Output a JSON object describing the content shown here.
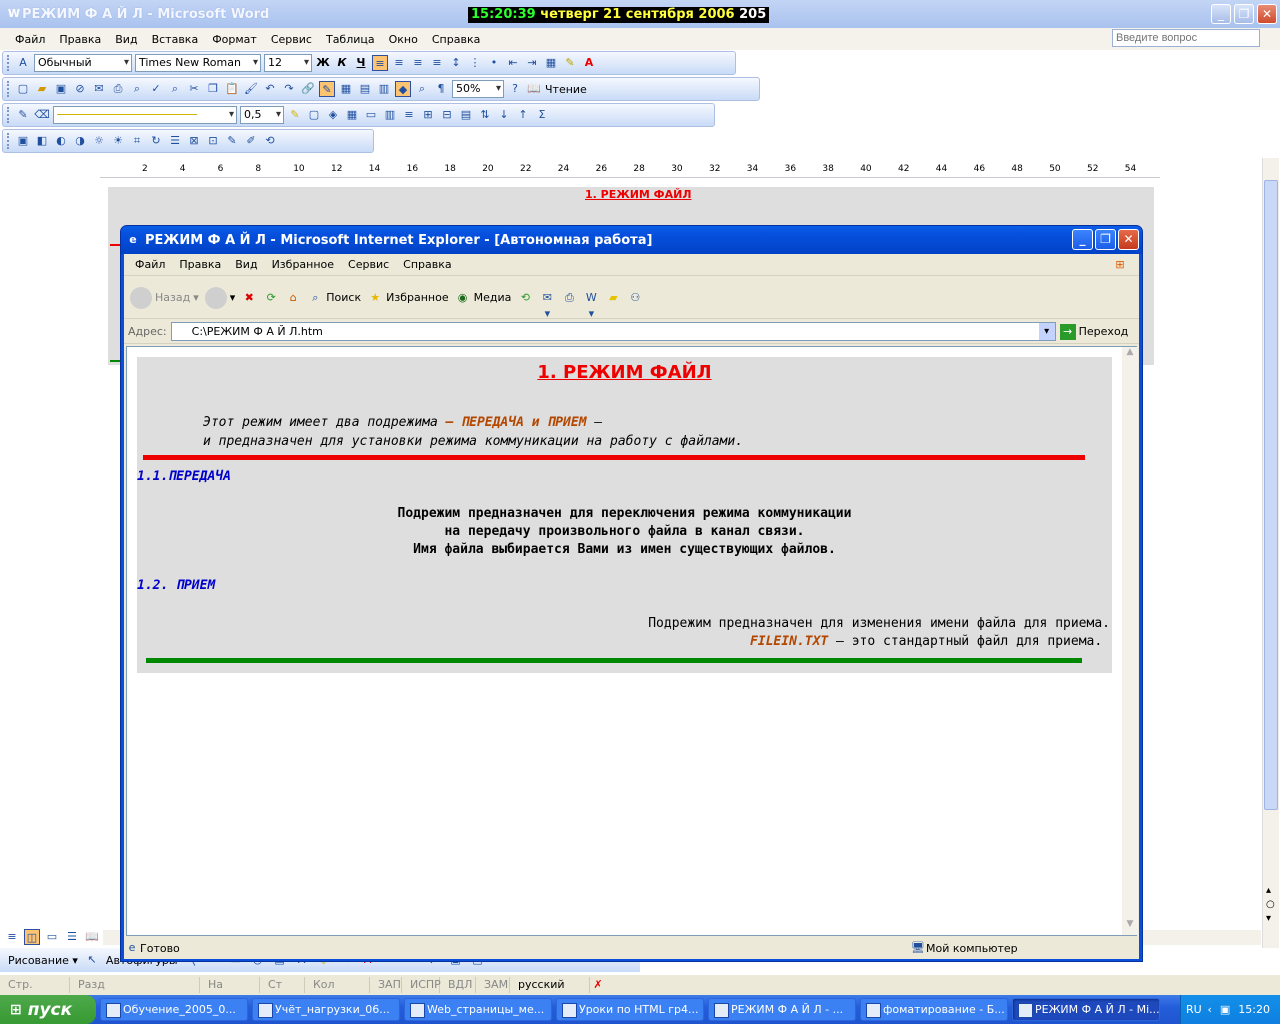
{
  "word": {
    "title": "РЕЖИМ  Ф А Й Л - Microsoft Word",
    "clock_time": "15:20:39",
    "clock_date": "четверг 21 сентября 2006",
    "clock_extra": "205",
    "menu": [
      "Файл",
      "Правка",
      "Вид",
      "Вставка",
      "Формат",
      "Сервис",
      "Таблица",
      "Окно",
      "Справка"
    ],
    "ask_placeholder": "Введите вопрос",
    "style": "Обычный",
    "font": "Times New Roman",
    "size": "12",
    "bold": "Ж",
    "italic": "К",
    "underline": "Ч",
    "zoom": "50%",
    "reading": "Чтение",
    "line_width": "0,5",
    "ruler": [
      "2",
      "4",
      "6",
      "8",
      "10",
      "12",
      "14",
      "16",
      "18",
      "20",
      "22",
      "24",
      "26",
      "28",
      "30",
      "32",
      "34",
      "36",
      "38",
      "40",
      "42",
      "44",
      "46",
      "48",
      "50",
      "52",
      "54"
    ],
    "doc_title": "1. РЕЖИМ  ФАЙЛ",
    "draw_label": "Рисование ▾",
    "autoshapes": "Автофигуры",
    "status": [
      "Стр.",
      "Разд",
      "На",
      "Ст",
      "Кол",
      "ЗАП",
      "ИСПР",
      "ВДЛ",
      "ЗАМ",
      "русский (Ро"
    ]
  },
  "ie": {
    "title": "РЕЖИМ Ф А Й Л - Microsoft Internet Explorer - [Автономная работа]",
    "menu": [
      "Файл",
      "Правка",
      "Вид",
      "Избранное",
      "Сервис",
      "Справка"
    ],
    "back": "Назад",
    "search": "Поиск",
    "favorites": "Избранное",
    "media": "Медиа",
    "address_label": "Адрес:",
    "address": "C:\\РЕЖИМ  Ф А Й Л.htm",
    "go": "Переход",
    "status_ready": "Готово",
    "status_zone": "Мой компьютер"
  },
  "page": {
    "title": "1. РЕЖИМ  ФАЙЛ",
    "intro1_a": "Этот режим имеет два подрежима ",
    "intro1_b": "– ПЕРЕДАЧА и ПРИЕМ",
    "intro1_c": " –",
    "intro2": "и предназначен для установки режима коммуникации на  работу с файлами.",
    "h_transfer": "1.1.ПЕРЕДАЧА",
    "t1": "Подрежим предназначен для переключения режима коммуникации",
    "t2": "на передачу произвольного файла в канал связи.",
    "t3": "Имя файла выбирается Вами из имен существующих файлов.",
    "h_receive": "1.2. ПРИЕМ",
    "r1": "Подрежим предназначен для изменения имени файла для приема.",
    "r2_a": "FILEIN.TXT",
    "r2_b": " – это стандартный файл для приема."
  },
  "taskbar": {
    "start": "пуск",
    "tasks": [
      "Обучение_2005_0...",
      "Учёт_нагрузки_06...",
      "Web_страницы_ме...",
      "Уроки по HTML гр4...",
      "РЕЖИМ  Ф А Й Л - ...",
      "фоматирование - Б...",
      "РЕЖИМ Ф А Й Л - Mi..."
    ],
    "lang": "RU",
    "time": "15:20"
  },
  "colors": {
    "accent_red": "#e00000",
    "accent_green": "#008000",
    "heading_blue": "#0000cc",
    "highlight_brown": "#b34700"
  }
}
